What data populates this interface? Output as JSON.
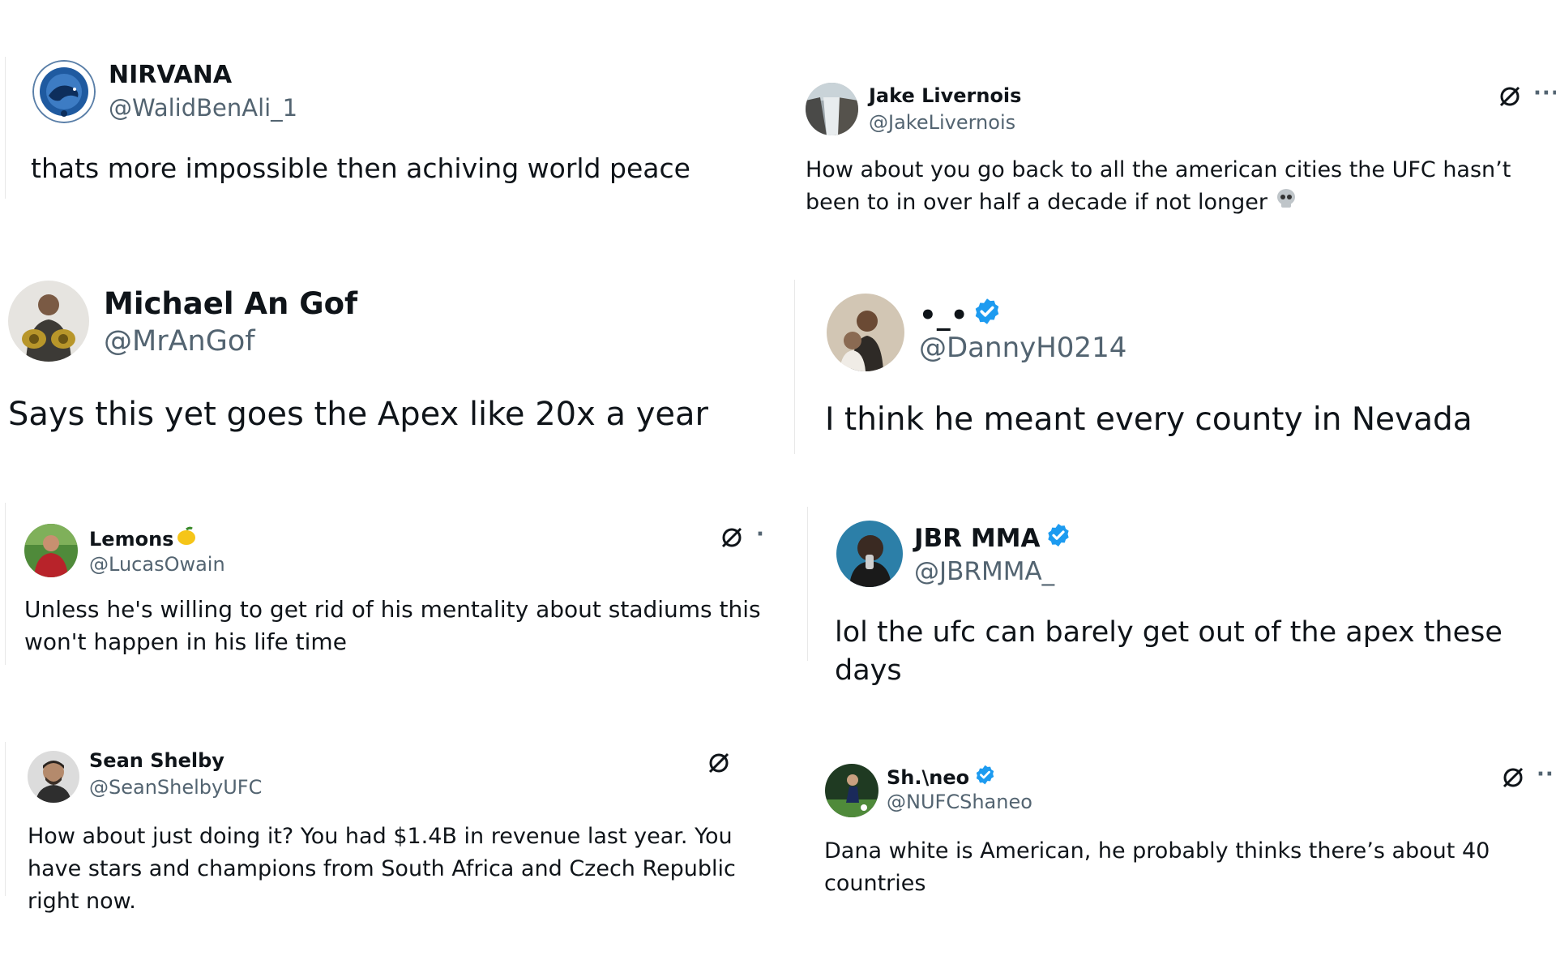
{
  "tweets": [
    {
      "name": "NIRVANA",
      "handle": "@WalidBenAli_1",
      "text": "thats more impossible then achiving world peace",
      "avatar_icon": "nirvana-logo-avatar"
    },
    {
      "name": "Jake Livernois",
      "handle": "@JakeLivernois",
      "text": "How about you go back to all the american cities the UFC hasn’t been to in over half a decade if not longer",
      "avatar_icon": "waterfall-avatar",
      "emoji": "skull-emoji"
    },
    {
      "name": "Michael An Gof",
      "handle": "@MrAnGof",
      "text": "Says this yet goes the Apex like 20x a year",
      "avatar_icon": "fighter-belts-avatar"
    },
    {
      "name": "•_•",
      "handle": "@DannyH0214",
      "text": "I think he meant every county in Nevada",
      "avatar_icon": "couple-photo-avatar",
      "verified": true
    },
    {
      "name": "Lemons",
      "handle": "@LucasOwain",
      "text": "Unless he's willing to get rid of his mentality about stadiums this won't happen in his life time",
      "avatar_icon": "person-red-avatar",
      "emoji": "lemon-emoji"
    },
    {
      "name": "JBR MMA",
      "handle": "@JBRMMA_",
      "text": "lol the ufc can barely get out of the apex these days",
      "avatar_icon": "microphone-avatar",
      "verified": true
    },
    {
      "name": "Sean Shelby",
      "handle": "@SeanShelbyUFC",
      "text": "How about just doing it? You had $1.4B in revenue last year. You have stars and champions from South Africa and Czech Republic right now.",
      "avatar_icon": "man-portrait-avatar"
    },
    {
      "name": "Sh.\\neo",
      "handle": "@NUFCShaneo",
      "text": "Dana white is American, he probably thinks there’s about 40 countries",
      "avatar_icon": "soccer-player-avatar",
      "verified": true
    }
  ],
  "ui": {
    "more_label": "···",
    "dot_label": "·"
  },
  "colors": {
    "verified": "#1d9bf0",
    "handle": "#536471",
    "text": "#0f1419"
  }
}
